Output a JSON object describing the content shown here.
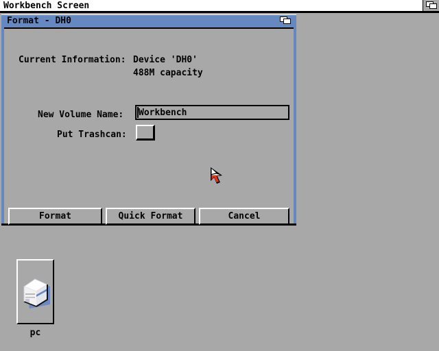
{
  "screen": {
    "title": "Workbench Screen",
    "background_color": "#a8a8a8",
    "titlebar_color": "#ffffff",
    "depth_gadget_icon": "depth-arrange-icon"
  },
  "window": {
    "title": "Format - DH0",
    "titlebar_color": "#6688c0",
    "depth_gadget_icon": "depth-arrange-icon",
    "info": {
      "label": "Current Information:",
      "device_line": "Device 'DH0'",
      "capacity_line": "488M capacity"
    },
    "volume": {
      "label": "New Volume Name:",
      "value": "Workbench",
      "placeholder": ""
    },
    "trashcan": {
      "label": "Put Trashcan:",
      "checked": false
    },
    "buttons": {
      "format": "Format",
      "quick_format": "Quick Format",
      "cancel": "Cancel"
    }
  },
  "desktop": {
    "icons": [
      {
        "label": "pc",
        "icon_name": "disk-drive-icon"
      }
    ]
  },
  "pointer": {
    "icon_name": "arrow-pointer-icon",
    "color": "#e83018"
  }
}
